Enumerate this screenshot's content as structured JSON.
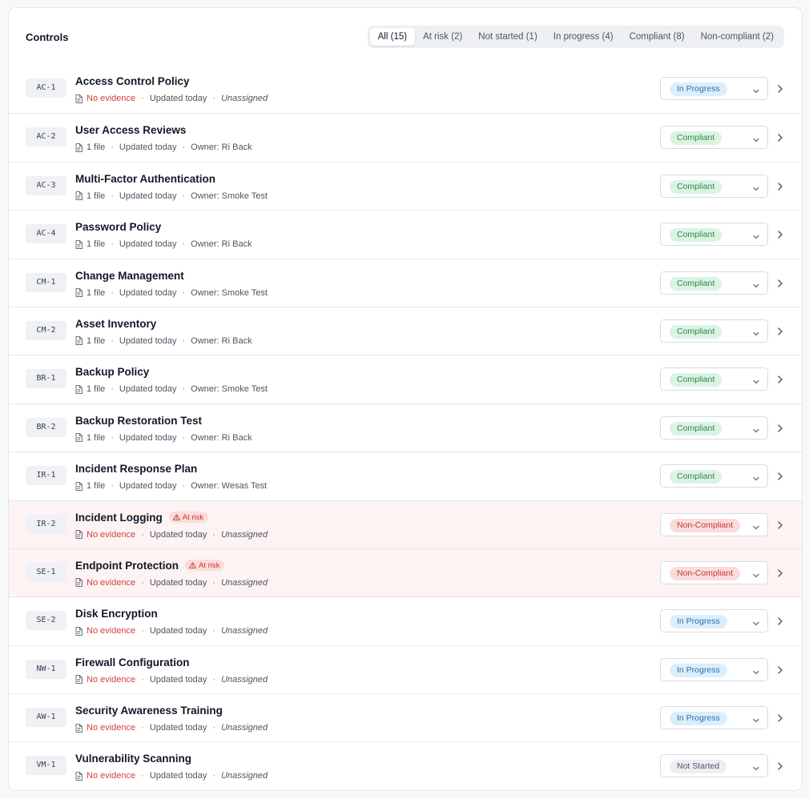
{
  "header": {
    "title": "Controls"
  },
  "tabs": [
    {
      "label": "All (15)",
      "active": true
    },
    {
      "label": "At risk (2)"
    },
    {
      "label": "Not started (1)"
    },
    {
      "label": "In progress (4)"
    },
    {
      "label": "Compliant (8)"
    },
    {
      "label": "Non-compliant (2)"
    }
  ],
  "controls": [
    {
      "code": "AC-1",
      "name": "Access Control Policy",
      "evidence": "No evidence",
      "updated": "Updated today",
      "owner": "Unassigned",
      "status": "In Progress",
      "status_kind": "inprogress",
      "at_risk": false
    },
    {
      "code": "AC-2",
      "name": "User Access Reviews",
      "evidence": "1 file",
      "updated": "Updated today",
      "owner": "Owner: Ri Back",
      "status": "Compliant",
      "status_kind": "compliant",
      "at_risk": false
    },
    {
      "code": "AC-3",
      "name": "Multi-Factor Authentication",
      "evidence": "1 file",
      "updated": "Updated today",
      "owner": "Owner: Smoke Test",
      "status": "Compliant",
      "status_kind": "compliant",
      "at_risk": false
    },
    {
      "code": "AC-4",
      "name": "Password Policy",
      "evidence": "1 file",
      "updated": "Updated today",
      "owner": "Owner: Ri Back",
      "status": "Compliant",
      "status_kind": "compliant",
      "at_risk": false
    },
    {
      "code": "CM-1",
      "name": "Change Management",
      "evidence": "1 file",
      "updated": "Updated today",
      "owner": "Owner: Smoke Test",
      "status": "Compliant",
      "status_kind": "compliant",
      "at_risk": false
    },
    {
      "code": "CM-2",
      "name": "Asset Inventory",
      "evidence": "1 file",
      "updated": "Updated today",
      "owner": "Owner: Ri Back",
      "status": "Compliant",
      "status_kind": "compliant",
      "at_risk": false
    },
    {
      "code": "BR-1",
      "name": "Backup Policy",
      "evidence": "1 file",
      "updated": "Updated today",
      "owner": "Owner: Smoke Test",
      "status": "Compliant",
      "status_kind": "compliant",
      "at_risk": false
    },
    {
      "code": "BR-2",
      "name": "Backup Restoration Test",
      "evidence": "1 file",
      "updated": "Updated today",
      "owner": "Owner: Ri Back",
      "status": "Compliant",
      "status_kind": "compliant",
      "at_risk": false
    },
    {
      "code": "IR-1",
      "name": "Incident Response Plan",
      "evidence": "1 file",
      "updated": "Updated today",
      "owner": "Owner: Wesas Test",
      "status": "Compliant",
      "status_kind": "compliant",
      "at_risk": false
    },
    {
      "code": "IR-2",
      "name": "Incident Logging",
      "evidence": "No evidence",
      "updated": "Updated today",
      "owner": "Unassigned",
      "status": "Non-Compliant",
      "status_kind": "noncompliant",
      "at_risk": true,
      "risk_label": "At risk"
    },
    {
      "code": "SE-1",
      "name": "Endpoint Protection",
      "evidence": "No evidence",
      "updated": "Updated today",
      "owner": "Unassigned",
      "status": "Non-Compliant",
      "status_kind": "noncompliant",
      "at_risk": true,
      "risk_label": "At risk"
    },
    {
      "code": "SE-2",
      "name": "Disk Encryption",
      "evidence": "No evidence",
      "updated": "Updated today",
      "owner": "Unassigned",
      "status": "In Progress",
      "status_kind": "inprogress",
      "at_risk": false
    },
    {
      "code": "NW-1",
      "name": "Firewall Configuration",
      "evidence": "No evidence",
      "updated": "Updated today",
      "owner": "Unassigned",
      "status": "In Progress",
      "status_kind": "inprogress",
      "at_risk": false
    },
    {
      "code": "AW-1",
      "name": "Security Awareness Training",
      "evidence": "No evidence",
      "updated": "Updated today",
      "owner": "Unassigned",
      "status": "In Progress",
      "status_kind": "inprogress",
      "at_risk": false
    },
    {
      "code": "VM-1",
      "name": "Vulnerability Scanning",
      "evidence": "No evidence",
      "updated": "Updated today",
      "owner": "Unassigned",
      "status": "Not Started",
      "status_kind": "notstarted",
      "at_risk": false
    }
  ],
  "icons": {
    "document": "document-icon",
    "warning": "warning-icon",
    "caret": "chevron-down-icon",
    "row_chevron": "chevron-right-icon"
  },
  "colors": {
    "risk_row_bg": "#fdf3f3",
    "no_evidence": "#d64040",
    "compliant": "#2e8a4f",
    "in_progress": "#2b6fa8",
    "non_compliant": "#c0392b"
  }
}
